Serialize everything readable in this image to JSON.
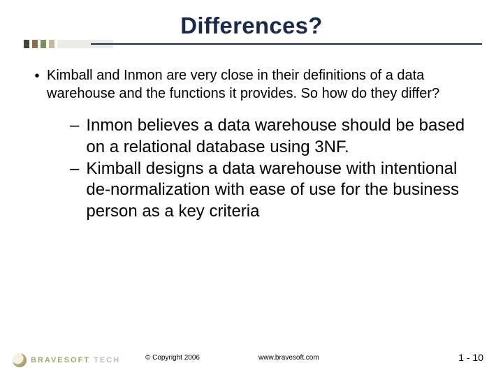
{
  "title": "Differences?",
  "bullets": {
    "l1": {
      "text": "Kimball and Inmon are very close in their definitions of a data warehouse and the functions it provides.  So how do they differ?"
    },
    "l2": [
      {
        "text": "Inmon believes a data warehouse should be based on a relational database using 3NF."
      },
      {
        "text": "Kimball designs a data warehouse with intentional de-normalization with ease of use for the business person as a key criteria"
      }
    ]
  },
  "footer": {
    "logo_a": "BRAVESOFT",
    "logo_b": "TECH",
    "copyright": "© Copyright 2006",
    "url": "www.bravesoft.com",
    "page": "1 - 10"
  }
}
